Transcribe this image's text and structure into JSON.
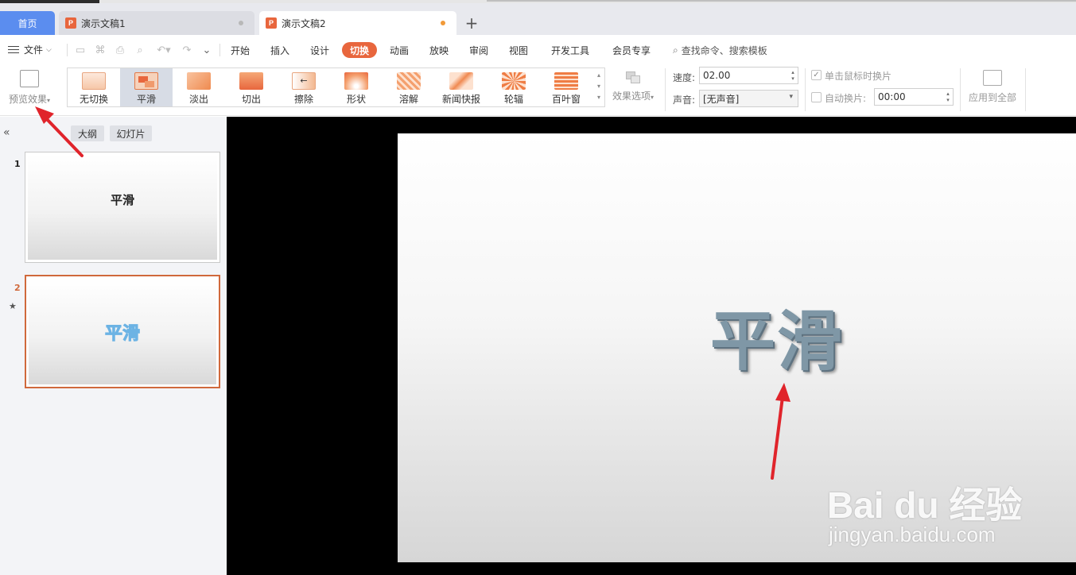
{
  "tabs": {
    "home": "首页",
    "doc1": "演示文稿1",
    "doc2": "演示文稿2",
    "doc_badge": "P",
    "new_tab": "+"
  },
  "menu": {
    "file": "文件",
    "items": [
      "开始",
      "插入",
      "设计",
      "切换",
      "动画",
      "放映",
      "审阅",
      "视图",
      "开发工具",
      "会员专享"
    ],
    "active": "切换",
    "search": "查找命令、搜索模板"
  },
  "ribbon": {
    "preview": "预览效果",
    "transitions": [
      "无切换",
      "平滑",
      "淡出",
      "切出",
      "擦除",
      "形状",
      "溶解",
      "新闻快报",
      "轮辐",
      "百叶窗"
    ],
    "selected_transition": "平滑",
    "effect_options": "效果选项",
    "speed_label": "速度:",
    "speed_value": "02.00",
    "sound_label": "声音:",
    "sound_value": "[无声音]",
    "click_advance": "单击鼠标时换片",
    "click_advance_checked": true,
    "auto_advance": "自动换片:",
    "auto_advance_checked": false,
    "auto_time": "00:00",
    "apply_all": "应用到全部"
  },
  "panel": {
    "outline_tab": "大纲",
    "slides_tab": "幻灯片",
    "slides": [
      {
        "number": "1",
        "title": "平滑"
      },
      {
        "number": "2",
        "title": "平滑"
      }
    ]
  },
  "slide": {
    "title": "平滑"
  },
  "watermark": {
    "brand": "Bai du 经验",
    "url": "jingyan.baidu.com"
  },
  "colors": {
    "accent": "#e8663d",
    "home_tab": "#5b8def",
    "annotation_arrow": "#e0242b"
  }
}
